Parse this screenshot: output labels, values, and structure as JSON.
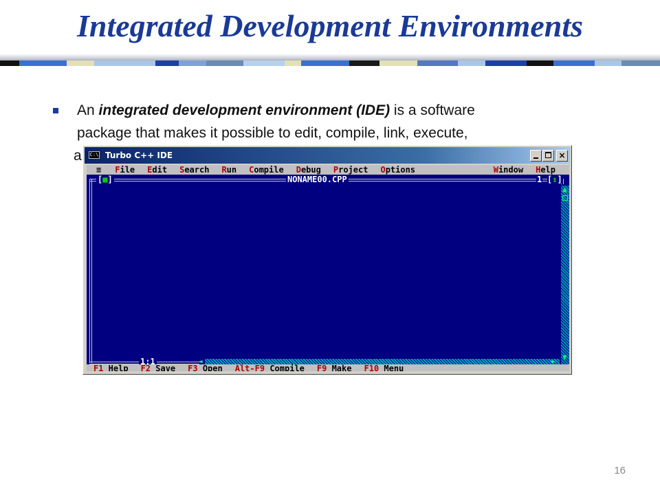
{
  "slide": {
    "title": "Integrated Development Environments",
    "bullet": {
      "prefix": "An ",
      "term": "integrated development environment (IDE)",
      "line1_rest": " is a software",
      "line2": "package that makes it possible to edit, compile, link, execute,",
      "line3_visible": "a"
    },
    "page_number": "16"
  },
  "window": {
    "title": "Turbo C++ IDE",
    "sys_icon_label": "C:\\",
    "buttons": {
      "close": "×"
    }
  },
  "ide": {
    "menu": {
      "system": "≡",
      "items": [
        {
          "hot": "F",
          "rest": "ile"
        },
        {
          "hot": "E",
          "rest": "dit"
        },
        {
          "hot": "S",
          "rest": "earch"
        },
        {
          "hot": "R",
          "rest": "un"
        },
        {
          "hot": "C",
          "rest": "ompile"
        },
        {
          "hot": "D",
          "rest": "ebug"
        },
        {
          "hot": "P",
          "rest": "roject"
        },
        {
          "hot": "O",
          "rest": "ptions"
        }
      ],
      "right_items": [
        {
          "hot": "W",
          "rest": "indow"
        },
        {
          "hot": "H",
          "rest": "elp"
        }
      ]
    },
    "editor": {
      "filename": "NONAME00.CPP",
      "close_box": {
        "left": "[",
        "mark": "■",
        "right": "]"
      },
      "window_number": "1",
      "zoom_box": {
        "left": "[",
        "mark": "↕",
        "right": "]"
      },
      "cursor_position": "1:1"
    },
    "statusbar": [
      {
        "key": "F1",
        "label": " Help"
      },
      {
        "key": "F2",
        "label": " Save"
      },
      {
        "key": "F3",
        "label": " Open"
      },
      {
        "key": "Alt-F9",
        "label": " Compile"
      },
      {
        "key": "F9",
        "label": " Make"
      },
      {
        "key": "F10",
        "label": " Menu"
      }
    ]
  },
  "colors": {
    "title_blue": "#1a3a96",
    "dos_background": "#000080",
    "menu_gray": "#c0c0c0",
    "hotkey_red": "#b00000"
  }
}
